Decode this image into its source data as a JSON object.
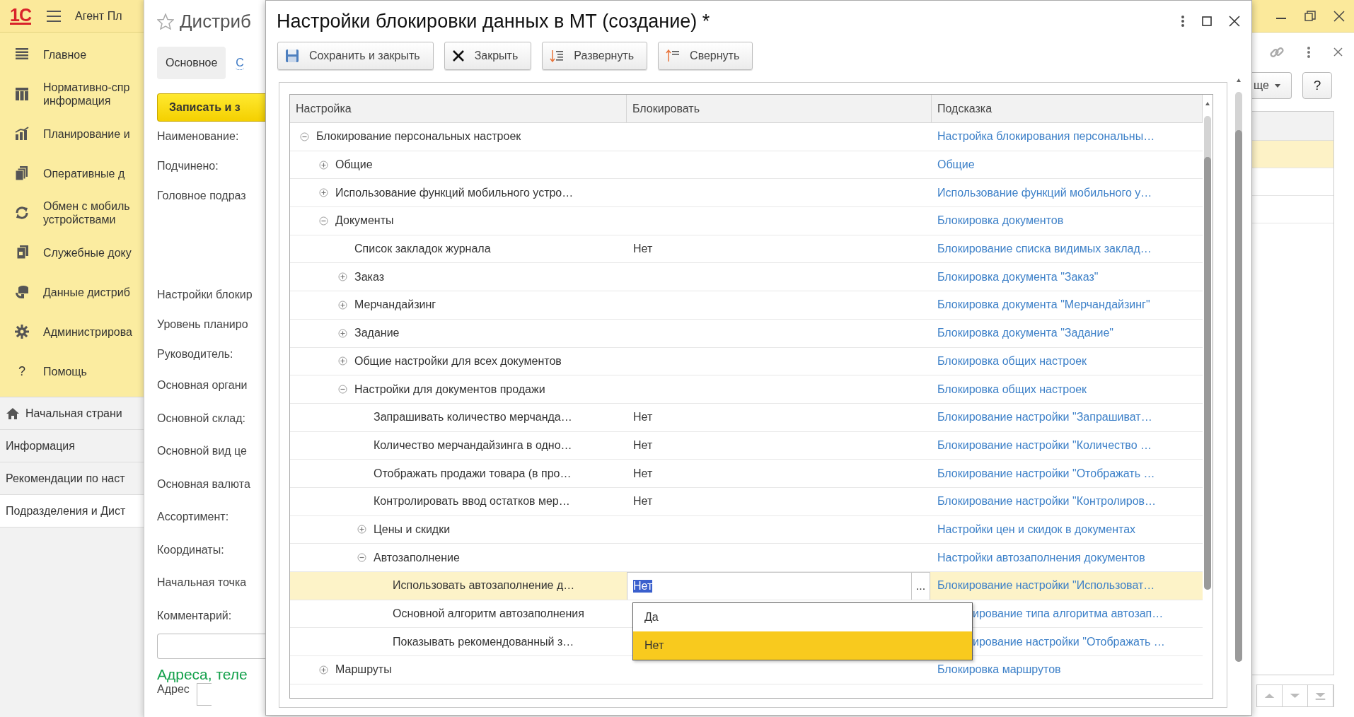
{
  "app": {
    "logo": "1С",
    "title": "Агент Пл"
  },
  "sections": [
    {
      "label": "Главное"
    },
    {
      "label": "Нормативно-спр информация"
    },
    {
      "label": "Планирование и"
    },
    {
      "label": "Оперативные д"
    },
    {
      "label": "Обмен с мобиль устройствами"
    },
    {
      "label": "Служебные доку"
    },
    {
      "label": "Данные дистриб"
    },
    {
      "label": "Администрирова"
    },
    {
      "label": "Помощь",
      "glyph": "?"
    }
  ],
  "open_windows": [
    {
      "label": "Начальная страни",
      "selected": false
    },
    {
      "label": "Информация",
      "selected": false
    },
    {
      "label": "Рекомендации по наст",
      "selected": false
    },
    {
      "label": "Подразделения и Дист",
      "selected": true
    }
  ],
  "form": {
    "title": "Дистриб",
    "tabs": [
      {
        "label": "Основное",
        "selected": true
      },
      {
        "label": "С",
        "selected": false
      }
    ],
    "save_button": "Записать и з",
    "fields": [
      "Наименование:",
      "Подчинено:",
      "Головное подраз",
      "Настройки блокир",
      "Уровень планиро",
      "Руководитель:",
      "Основная органи",
      "Основной склад:",
      "Основной вид це",
      "Основная валюта",
      "Ассортимент:",
      "Координаты:",
      "Начальная точка",
      "Комментарий:"
    ],
    "section_heading": "Адреса, теле",
    "address_label": "Адрес"
  },
  "dialog": {
    "title": "Настройки блокировки данных в МТ (создание) *",
    "buttons": [
      {
        "label": "Сохранить и закрыть",
        "kind": "save"
      },
      {
        "label": "Закрыть",
        "kind": "close"
      },
      {
        "label": "Развернуть",
        "kind": "expand"
      },
      {
        "label": "Свернуть",
        "kind": "collapse"
      }
    ],
    "columns": [
      "Настройка",
      "Блокировать",
      "Подсказка"
    ],
    "edit_button": "...",
    "rows": [
      {
        "name": "Блокирование персональных настроек",
        "hint": "Настройка блокирования персональны…",
        "kind": "group",
        "expanded": true,
        "selected": false,
        "children": [
          {
            "name": "Общие",
            "hint": "Общие",
            "kind": "group",
            "expanded": false,
            "selected": false
          },
          {
            "name": "Использование функций мобильного устро…",
            "hint": "Использование функций мобильного у…",
            "kind": "group",
            "expanded": false,
            "selected": false
          },
          {
            "name": "Документы",
            "hint": "Блокировка документов",
            "kind": "group",
            "expanded": true,
            "selected": false,
            "children": [
              {
                "name": "Список закладок журнала",
                "value": "Нет",
                "hint": "Блокирование списка видимых заклад…",
                "kind": "setting",
                "selected": false
              },
              {
                "name": "Заказ",
                "hint": "Блокировка документа \"Заказ\"",
                "kind": "group",
                "expanded": false,
                "selected": false
              },
              {
                "name": "Мерчандайзинг",
                "hint": "Блокировка документа \"Мерчандайзинг\"",
                "kind": "group",
                "expanded": false,
                "selected": false
              },
              {
                "name": "Задание",
                "hint": "Блокировка документа \"Задание\"",
                "kind": "group",
                "expanded": false,
                "selected": false
              },
              {
                "name": "Общие настройки для всех документов",
                "hint": "Блокировка общих настроек",
                "kind": "group",
                "expanded": false,
                "selected": false
              },
              {
                "name": "Настройки для документов продажи",
                "hint": "Блокировка общих настроек",
                "kind": "group",
                "expanded": true,
                "selected": false,
                "children": [
                  {
                    "name": "Запрашивать количество мерчанда…",
                    "value": "Нет",
                    "hint": "Блокирование настройки \"Запрашиват…",
                    "kind": "setting",
                    "selected": false
                  },
                  {
                    "name": "Количество мерчандайзинга в одно…",
                    "value": "Нет",
                    "hint": "Блокирование настройки \"Количество …",
                    "kind": "setting",
                    "selected": false
                  },
                  {
                    "name": "Отображать продажи товара (в про…",
                    "value": "Нет",
                    "hint": "Блокирование настройки \"Отображать …",
                    "kind": "setting",
                    "selected": false
                  },
                  {
                    "name": "Контролировать ввод остатков мер…",
                    "value": "Нет",
                    "hint": "Блокирование настройки \"Контролиров…",
                    "kind": "setting",
                    "selected": false
                  },
                  {
                    "name": "Цены и скидки",
                    "hint": "Настройки цен и скидок в документах",
                    "kind": "group",
                    "expanded": false,
                    "selected": false
                  },
                  {
                    "name": "Автозаполнение",
                    "hint": "Настройки автозаполнения документов",
                    "kind": "group",
                    "expanded": true,
                    "selected": false,
                    "children": [
                      {
                        "name": "Использовать автозаполнение д…",
                        "value": "Нет",
                        "hint": "Блокирование настройки \"Использоват…",
                        "kind": "setting",
                        "selected": true
                      },
                      {
                        "name": "Основной алгоритм автозаполнения",
                        "hint": "ирование типа алгоритма автозап…",
                        "kind": "setting",
                        "selected": false
                      },
                      {
                        "name": "Показывать рекомендованный з…",
                        "hint": "ирование настройки \"Отображать …",
                        "kind": "setting",
                        "selected": false
                      }
                    ]
                  }
                ]
              }
            ]
          },
          {
            "name": "Маршруты",
            "hint": "Блокировка маршрутов",
            "kind": "group",
            "expanded": false,
            "selected": false
          }
        ]
      }
    ],
    "popup": {
      "options": [
        {
          "label": "Да",
          "selected": false
        },
        {
          "label": "Нет",
          "selected": true
        }
      ]
    }
  },
  "right": {
    "more_button": "ще",
    "help_button": "?",
    "rows": [
      {
        "selected": true
      },
      {
        "selected": false
      },
      {
        "selected": false
      }
    ]
  }
}
